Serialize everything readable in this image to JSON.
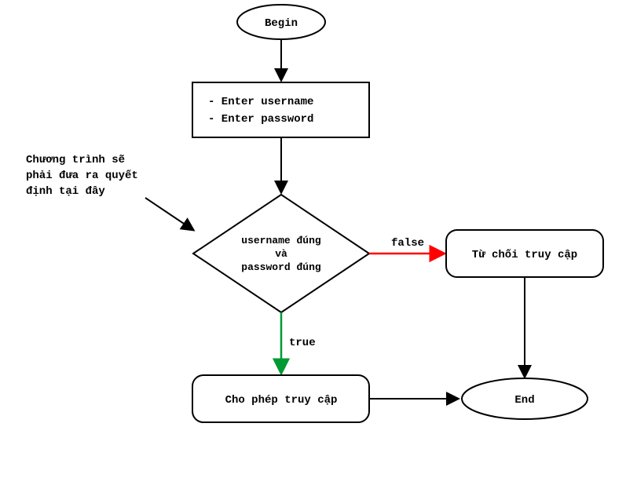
{
  "flowchart": {
    "nodes": {
      "begin": {
        "label": "Begin"
      },
      "input": {
        "line1": "- Enter username",
        "line2": "- Enter password"
      },
      "decision": {
        "line1": "username đúng",
        "line2": "và",
        "line3": "password đúng"
      },
      "deny": {
        "label": "Từ chối truy cập"
      },
      "allow": {
        "label": "Cho phép truy cập"
      },
      "end": {
        "label": "End"
      }
    },
    "edges": {
      "true": "true",
      "false": "false"
    },
    "annotation": {
      "line1": "Chương trình sẽ",
      "line2": "phải đưa ra quyết",
      "line3": "định tại đây"
    }
  }
}
